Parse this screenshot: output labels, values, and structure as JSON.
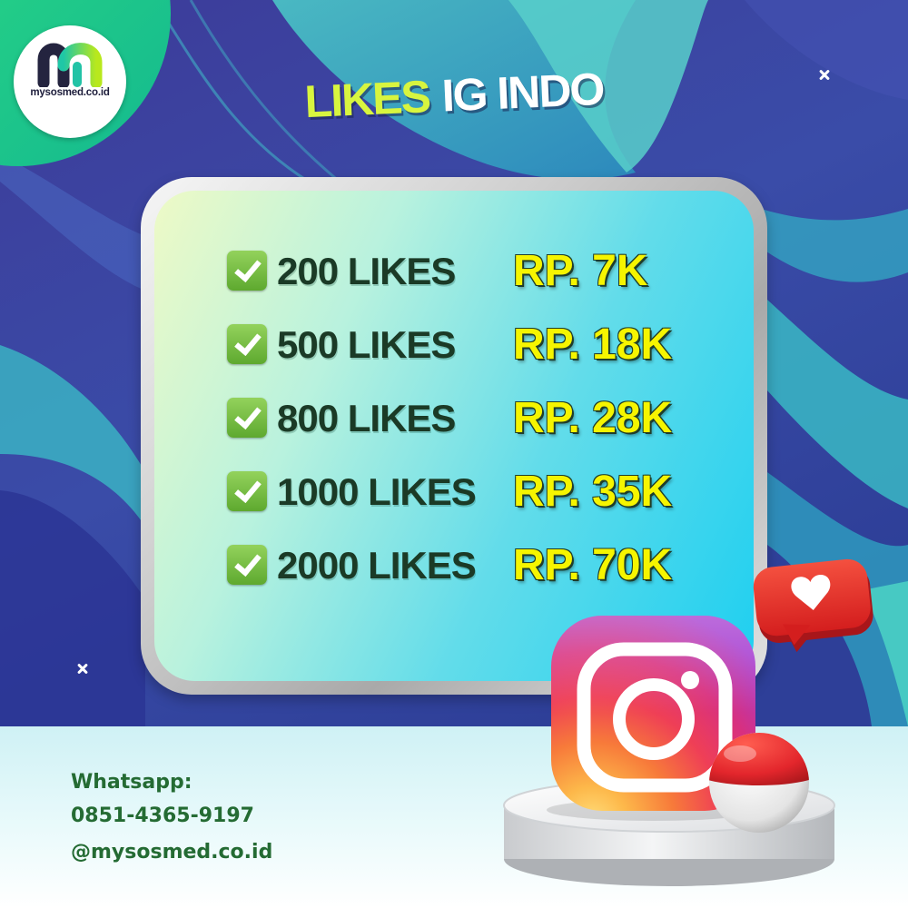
{
  "logo": {
    "text": "mysosmed.co.id"
  },
  "title": {
    "highlight": "LIKES",
    "rest": "IG INDO"
  },
  "packages": [
    {
      "quantity": "200 LIKES",
      "price": "RP. 7K"
    },
    {
      "quantity": "500 LIKES",
      "price": "RP. 18K"
    },
    {
      "quantity": "800 LIKES",
      "price": "RP. 28K"
    },
    {
      "quantity": "1000 LIKES",
      "price": "RP. 35K"
    },
    {
      "quantity": "2000 LIKES",
      "price": "RP. 70K"
    }
  ],
  "contact": {
    "label": "Whatsapp:",
    "phone": "0851-4365-9197",
    "handle": "@mysosmed.co.id"
  },
  "icons": [
    "logo-mark-icon",
    "check-icon",
    "instagram-icon",
    "heart-bubble-icon",
    "indonesia-flag-icon",
    "sparkle-icon"
  ],
  "colors": {
    "title_highlight": "#d8f53f",
    "title_rest": "#ffffff",
    "package_label": "#1b3a26",
    "price": "#f6f500",
    "contact_text": "#246b33",
    "card_accent": "#1ecff0",
    "background": "#3a45a2"
  }
}
